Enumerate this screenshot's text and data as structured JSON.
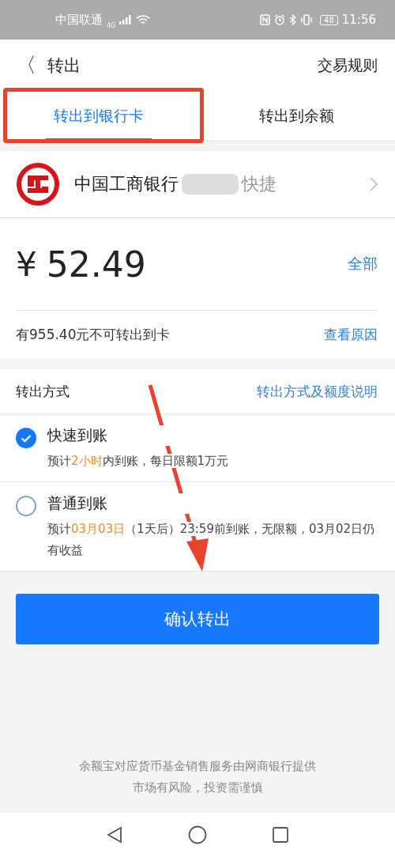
{
  "status_bar": {
    "carrier": "中国联通",
    "network": "4G",
    "battery": "48",
    "time": "11:56"
  },
  "header": {
    "back": "〈",
    "title": "转出",
    "action": "交易规则"
  },
  "tabs": [
    {
      "label": "转出到银行卡",
      "selected": true
    },
    {
      "label": "转出到余额",
      "selected": false
    }
  ],
  "bank": {
    "name": "中国工商银行",
    "type": "快捷"
  },
  "amount": {
    "currency": "¥",
    "value": "52.49",
    "action": "全部"
  },
  "notice": {
    "text": "有955.40元不可转出到卡",
    "link": "查看原因"
  },
  "methods_header": {
    "title": "转出方式",
    "link": "转出方式及额度说明"
  },
  "methods": [
    {
      "title": "快速到账",
      "selected": true,
      "parts": [
        {
          "text": "预计",
          "highlight": false
        },
        {
          "text": "2小时",
          "highlight": true
        },
        {
          "text": "内到账，每日限额1万元",
          "highlight": false
        }
      ]
    },
    {
      "title": "普通到账",
      "selected": false,
      "parts": [
        {
          "text": "预计",
          "highlight": false
        },
        {
          "text": "03月03日",
          "highlight": true
        },
        {
          "text": "（1天后）23:59前到账，无限额，03月02日仍有收益",
          "highlight": false
        }
      ]
    }
  ],
  "confirm_button": "确认转出",
  "footer": [
    "余额宝对应货币基金销售服务由网商银行提供",
    "市场有风险，投资需谨慎"
  ]
}
